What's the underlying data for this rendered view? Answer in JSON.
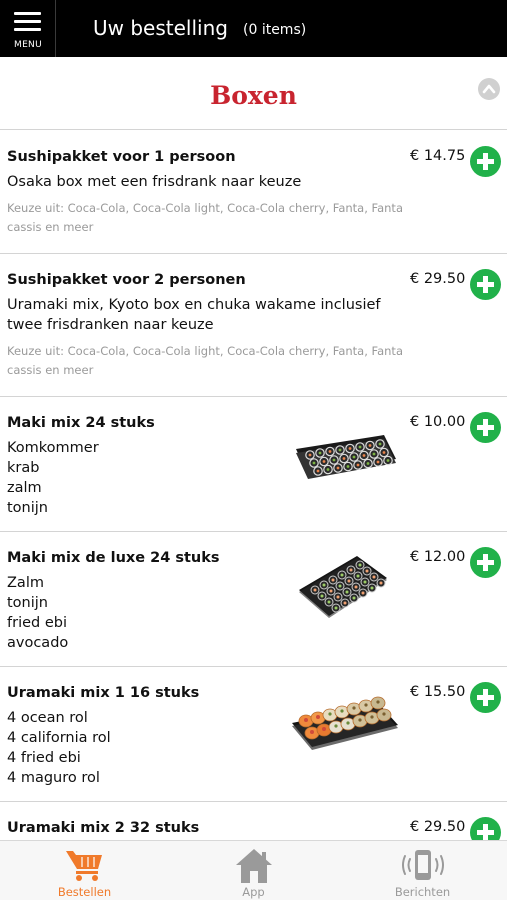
{
  "header": {
    "menu_label": "MENU",
    "title": "Uw bestelling",
    "items_count": "(0 items)"
  },
  "section": {
    "title": "Boxen"
  },
  "items": [
    {
      "name": "Sushipakket voor 1 persoon",
      "price": "€ 14.75",
      "description": "Osaka box met een frisdrank naar keuze",
      "note": "Keuze uit: Coca-Cola, Coca-Cola light, Coca-Cola cherry, Fanta, Fanta cassis en meer"
    },
    {
      "name": "Sushipakket voor 2 personen",
      "price": "€ 29.50",
      "description": "Uramaki mix, Kyoto box en chuka wakame inclusief twee frisdranken naar keuze",
      "note": "Keuze uit: Coca-Cola, Coca-Cola light, Coca-Cola cherry, Fanta, Fanta cassis en meer"
    },
    {
      "name": "Maki mix 24 stuks",
      "price": "€ 10.00",
      "contents": [
        "Komkommer",
        "krab",
        "zalm",
        "tonijn"
      ]
    },
    {
      "name": "Maki mix de luxe 24 stuks",
      "price": "€ 12.00",
      "contents": [
        "Zalm",
        "tonijn",
        "fried ebi",
        "avocado"
      ]
    },
    {
      "name": "Uramaki mix 1 16 stuks",
      "price": "€ 15.50",
      "contents": [
        "4 ocean rol",
        "4 california rol",
        "4 fried ebi",
        "4 maguro rol"
      ]
    },
    {
      "name": "Uramaki mix 2 32 stuks",
      "price": "€ 29.50"
    }
  ],
  "tabs": [
    {
      "label": "Bestellen",
      "icon": "cart-icon",
      "active": true
    },
    {
      "label": "App",
      "icon": "home-icon",
      "active": false
    },
    {
      "label": "Berichten",
      "icon": "phone-vibrate-icon",
      "active": false
    }
  ],
  "colors": {
    "topbar": "#000000",
    "section_title": "#c8242f",
    "add_button": "#21b14a",
    "active_tab": "#f07a2b",
    "inactive_tab": "#9a9a9a"
  }
}
